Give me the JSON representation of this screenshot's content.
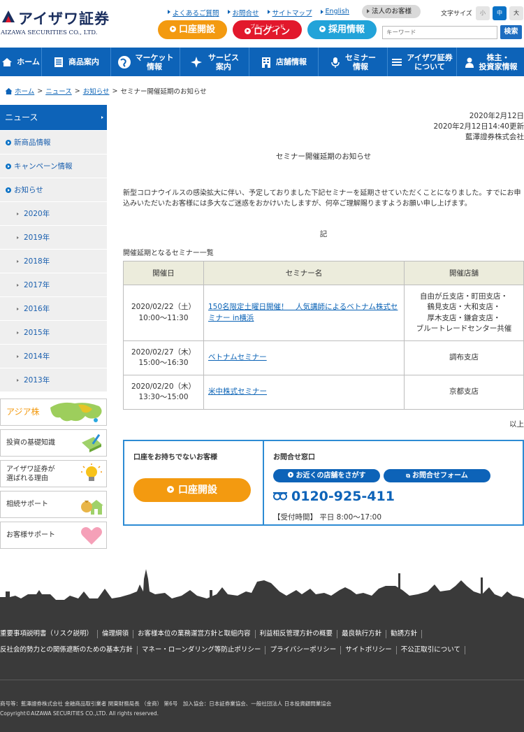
{
  "brand": {
    "name_jp": "アイザワ証券",
    "name_en": "AIZAWA SECURITIES CO., LTD."
  },
  "header": {
    "util_links": [
      "よくあるご質問",
      "お問合せ",
      "サイトマップ",
      "English"
    ],
    "corp_button": "法人のお客様",
    "fontsize_label": "文字サイズ",
    "fontsize": {
      "small": "小",
      "mid": "中",
      "large": "大"
    },
    "open_account": "口座開設",
    "login_sub": "ブルートレード",
    "login": "ログイン",
    "recruit": "採用情報",
    "search_placeholder": "キーワード",
    "search_button": "検索"
  },
  "nav": [
    {
      "label": "ホーム",
      "icon": "home-icon"
    },
    {
      "label": "商品案内",
      "icon": "document-icon"
    },
    {
      "label": "マーケット\n情報",
      "icon": "globe-icon"
    },
    {
      "label": "サービス\n案内",
      "icon": "sparkle-icon"
    },
    {
      "label": "店舗情報",
      "icon": "building-icon"
    },
    {
      "label": "セミナー\n情報",
      "icon": "microphone-icon"
    },
    {
      "label": "アイザワ証券\nについて",
      "icon": "menu-lines-icon"
    },
    {
      "label": "株主・\n投資家情報",
      "icon": "person-icon"
    }
  ],
  "breadcrumb": {
    "home": "ホーム",
    "news": "ニュース",
    "notice": "お知らせ",
    "current": "セミナー開催延期のお知らせ"
  },
  "sidebar": {
    "heading": "ニュース",
    "categories": [
      "新商品情報",
      "キャンペーン情報",
      "お知らせ"
    ],
    "years": [
      "2020年",
      "2019年",
      "2018年",
      "2017年",
      "2016年",
      "2015年",
      "2014年",
      "2013年"
    ],
    "banners": [
      {
        "label": "アジア株",
        "icon": "asia-map-icon"
      },
      {
        "label": "投資の基礎知識",
        "icon": "book-pen-icon"
      },
      {
        "label": "アイザワ証券が\n選ばれる理由",
        "icon": "lightbulb-icon"
      },
      {
        "label": "相続サポート",
        "icon": "house-moneybag-icon"
      },
      {
        "label": "お客様サポート",
        "icon": "heart-icon"
      }
    ]
  },
  "article": {
    "date": "2020年2月12日",
    "updated": "2020年2月12日14:40更新",
    "company": "藍澤證券株式会社",
    "title": "セミナー開催延期のお知らせ",
    "intro": "新型コロナウイルスの感染拡大に伴い、予定しておりました下記セミナーを延期させていただくことになりました。すでにお申込みいただいたお客様には多大なご迷惑をおかけいたしますが、何卒ご理解賜りますようお願い申し上げます。",
    "ki": "記",
    "list_title": "開催延期となるセミナー一覧",
    "table_headers": [
      "開催日",
      "セミナー名",
      "開催店舗"
    ],
    "rows": [
      {
        "date": "2020/02/22（土）\n10:00～11:30",
        "name": "150名限定土曜日開催！　人気講師によるベトナム株式セミナー in横浜",
        "branch": "自由が丘支店・町田支店・\n鶴見支店・大和支店・\n厚木支店・鎌倉支店・\nブルートレードセンター共催"
      },
      {
        "date": "2020/02/27（木）\n15:00～16:30",
        "name": "ベトナムセミナー",
        "branch": "調布支店"
      },
      {
        "date": "2020/02/20（木）\n13:30～15:00",
        "name": "米中株式セミナー",
        "branch": "京都支店"
      }
    ],
    "ijo": "以上"
  },
  "contact": {
    "left_title": "口座をお持ちでないお客様",
    "open_account": "口座開設",
    "right_title": "お問合せ窓口",
    "near_store": "お近くの店舗をさがす",
    "form": "お問合せフォーム",
    "phone": "0120-925-411",
    "hours": "【受付時間】 平日 8:00～17:00"
  },
  "footer": {
    "links_row1": [
      "重要事項説明書（リスク説明）",
      "倫理綱領",
      "お客様本位の業務運営方針と取組内容",
      "利益相反管理方針の概要",
      "最良執行方針",
      "勧誘方針"
    ],
    "links_row2": [
      "反社会的勢力との関係遮断のための基本方針",
      "マネー・ローンダリング等防止ポリシー",
      "プライバシーポリシー",
      "サイトポリシー",
      "不公正取引について"
    ],
    "legal": "商号等：藍澤證券株式会社 金融商品取引業者 関東財務局長 （金商） 第6号　加入協会：日本証券業協会、一般社団法人 日本投資顧問業協会",
    "copyright": "Copyright©AIZAWA SECURITIES CO.,LTD. All rights reserved."
  },
  "colors": {
    "primary_blue": "#0d63b8",
    "orange": "#f39a10",
    "red": "#e2182c",
    "light_blue": "#22a3d9",
    "footer_bg": "#3a3a3a"
  }
}
